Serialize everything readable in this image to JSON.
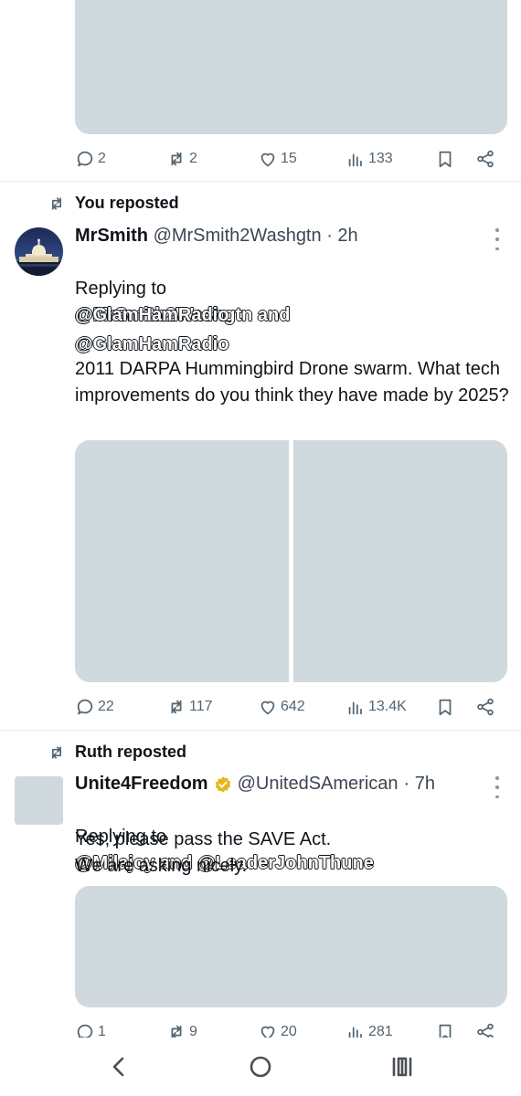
{
  "post1": {
    "actions": {
      "replies": "2",
      "reposts": "2",
      "likes": "15",
      "views": "133"
    }
  },
  "post2": {
    "repost_label": "You reposted",
    "author_name": "MrSmith",
    "author_handle": "@MrSmith2Washgtn",
    "time": "· 2h",
    "replying_to_prefix": "Replying to",
    "replying_to_mentions": "@MrSmith2Washgtn and",
    "replying_to_mention2": "@GlamHamRadio",
    "body_mention": "@GlamHamRadio",
    "body_text": "2011 DARPA Hummingbird Drone swarm.  What tech improvements do you think they have made by 2025?",
    "actions": {
      "replies": "22",
      "reposts": "117",
      "likes": "642",
      "views": "13.4K"
    }
  },
  "post3": {
    "repost_label": "Ruth reposted",
    "author_name": "Unite4Freedom",
    "verified_color": "#e2b719",
    "author_handle": "@UnitedSAmerican",
    "time": "· 7h",
    "replying_to_prefix": "Replying to",
    "replying_to_mentions": "@Milajoy and @LeaderJohnThune",
    "body_text": "Yes, please pass the SAVE Act.\nWe are asking nicely.",
    "actions": {
      "replies": "1",
      "reposts": "9",
      "likes": "20",
      "views": "281"
    }
  },
  "icons": {
    "reply": "speech-bubble-icon",
    "repost": "repost-arrows-icon",
    "like": "heart-icon",
    "views": "bar-chart-icon",
    "bookmark": "bookmark-icon",
    "share": "share-nodes-icon"
  },
  "nav": {
    "back": "back-chevron-icon",
    "home": "home-circle-icon",
    "recents": "recents-bars-icon"
  }
}
